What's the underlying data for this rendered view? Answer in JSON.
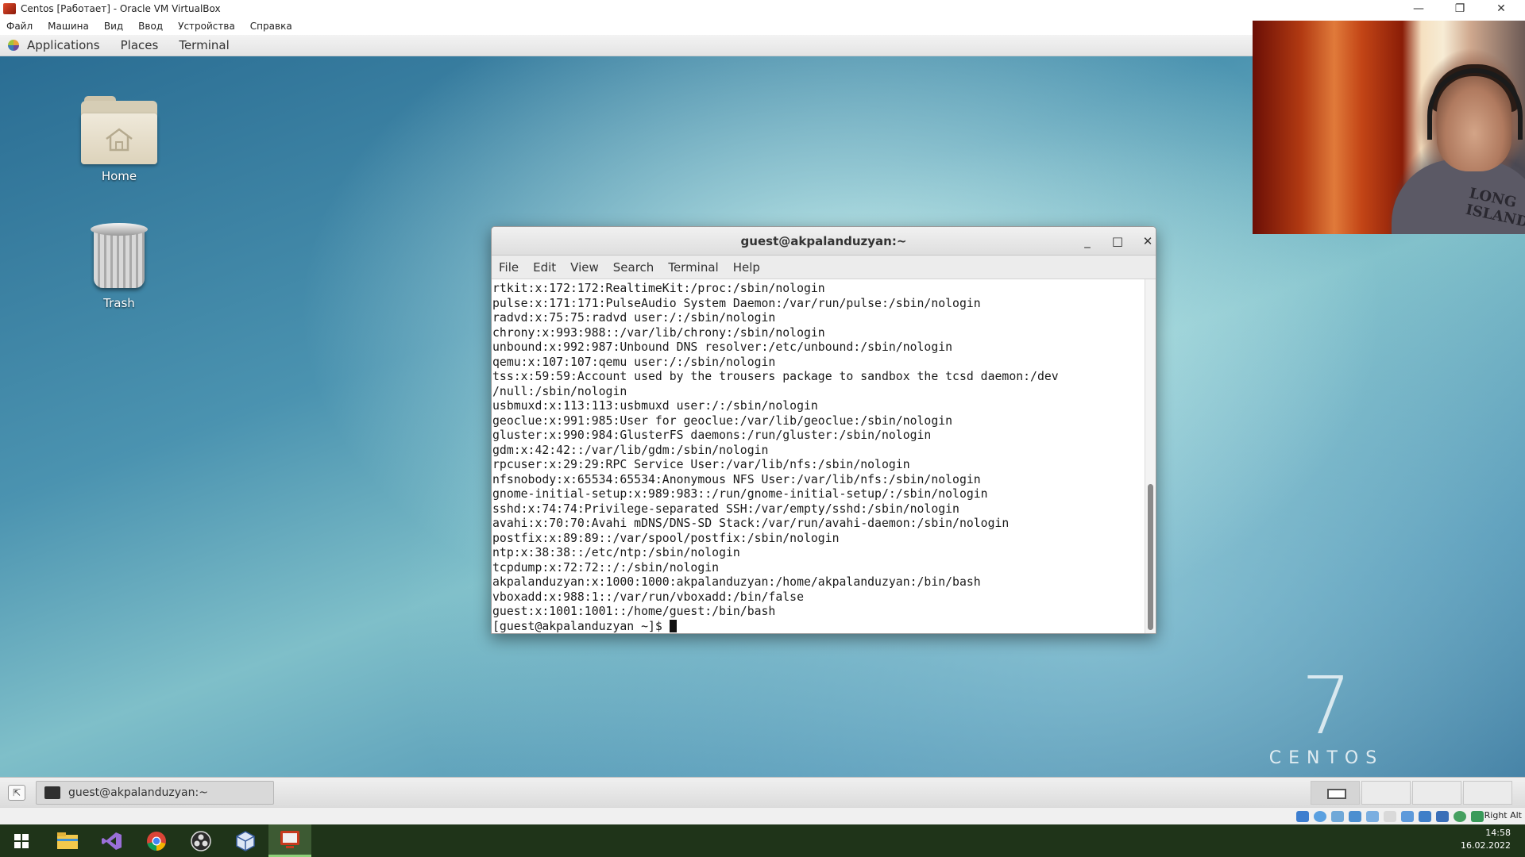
{
  "host_window": {
    "title": "Centos [Работает] - Oracle VM VirtualBox",
    "controls": [
      "—",
      "❐",
      "✕"
    ],
    "menu": [
      "Файл",
      "Машина",
      "Вид",
      "Ввод",
      "Устройства",
      "Справка"
    ]
  },
  "guest_topbar": {
    "items": [
      "Applications",
      "Places",
      "Terminal"
    ]
  },
  "desktop": {
    "icons": [
      {
        "label": "Home",
        "icon": "home-folder-icon"
      },
      {
        "label": "Trash",
        "icon": "trash-icon"
      }
    ],
    "logo": {
      "number": "7",
      "word": "CENTOS"
    }
  },
  "terminal": {
    "title": "guest@akpalanduzyan:~",
    "controls": [
      "_",
      "□",
      "✕"
    ],
    "menu": [
      "File",
      "Edit",
      "View",
      "Search",
      "Terminal",
      "Help"
    ],
    "lines": [
      "rtkit:x:172:172:RealtimeKit:/proc:/sbin/nologin",
      "pulse:x:171:171:PulseAudio System Daemon:/var/run/pulse:/sbin/nologin",
      "radvd:x:75:75:radvd user:/:/sbin/nologin",
      "chrony:x:993:988::/var/lib/chrony:/sbin/nologin",
      "unbound:x:992:987:Unbound DNS resolver:/etc/unbound:/sbin/nologin",
      "qemu:x:107:107:qemu user:/:/sbin/nologin",
      "tss:x:59:59:Account used by the trousers package to sandbox the tcsd daemon:/dev",
      "/null:/sbin/nologin",
      "usbmuxd:x:113:113:usbmuxd user:/:/sbin/nologin",
      "geoclue:x:991:985:User for geoclue:/var/lib/geoclue:/sbin/nologin",
      "gluster:x:990:984:GlusterFS daemons:/run/gluster:/sbin/nologin",
      "gdm:x:42:42::/var/lib/gdm:/sbin/nologin",
      "rpcuser:x:29:29:RPC Service User:/var/lib/nfs:/sbin/nologin",
      "nfsnobody:x:65534:65534:Anonymous NFS User:/var/lib/nfs:/sbin/nologin",
      "gnome-initial-setup:x:989:983::/run/gnome-initial-setup/:/sbin/nologin",
      "sshd:x:74:74:Privilege-separated SSH:/var/empty/sshd:/sbin/nologin",
      "avahi:x:70:70:Avahi mDNS/DNS-SD Stack:/var/run/avahi-daemon:/sbin/nologin",
      "postfix:x:89:89::/var/spool/postfix:/sbin/nologin",
      "ntp:x:38:38::/etc/ntp:/sbin/nologin",
      "tcpdump:x:72:72::/:/sbin/nologin",
      "akpalanduzyan:x:1000:1000:akpalanduzyan:/home/akpalanduzyan:/bin/bash",
      "vboxadd:x:988:1::/var/run/vboxadd:/bin/false",
      "guest:x:1001:1001::/home/guest:/bin/bash"
    ],
    "prompt": "[guest@akpalanduzyan ~]$ "
  },
  "guest_bottombar": {
    "task_label": "guest@akpalanduzyan:~",
    "workspaces": 4
  },
  "statusbar": {
    "hostkey": "Right Alt"
  },
  "windows_taskbar": {
    "apps": [
      "start-icon",
      "file-explorer-icon",
      "visual-studio-icon",
      "chrome-icon",
      "obs-icon",
      "virtualbox-manager-icon",
      "virtualbox-vm-icon"
    ],
    "time": "14:58",
    "date": "16.02.2022"
  },
  "webcam": {
    "shirt_text": "LONG ISLAND"
  },
  "colors": {
    "taskbar": "#1f3419",
    "terminal_bg": "#ffffff",
    "desktop_accent": "#4b93b0"
  }
}
